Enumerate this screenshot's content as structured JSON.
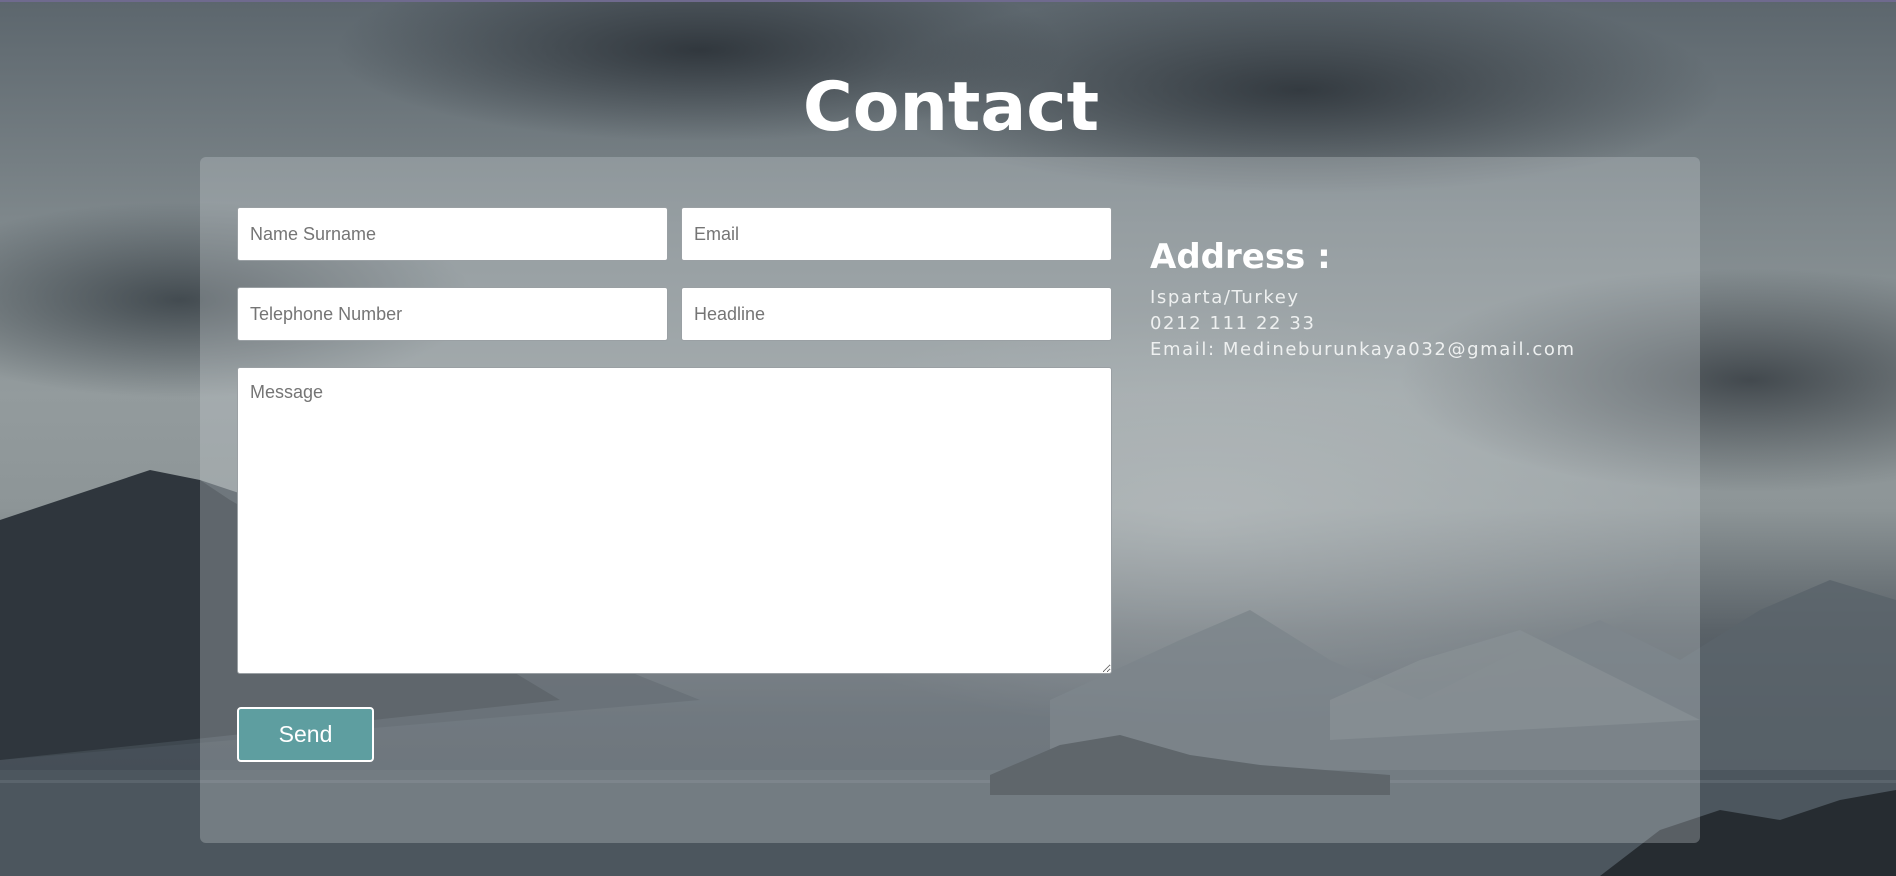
{
  "page": {
    "title": "Contact"
  },
  "form": {
    "name_placeholder": "Name Surname",
    "email_placeholder": "Email",
    "phone_placeholder": "Telephone Number",
    "headline_placeholder": "Headline",
    "message_placeholder": "Message",
    "send_label": "Send"
  },
  "info": {
    "title": "Address :",
    "location": "Isparta/Turkey",
    "phone": "0212 111 22 33",
    "email": "Email: Medineburunkaya032@gmail.com"
  },
  "colors": {
    "send_button": "#5e9ea0",
    "panel": "rgba(200,205,207,0.32)",
    "text": "#ffffff"
  }
}
